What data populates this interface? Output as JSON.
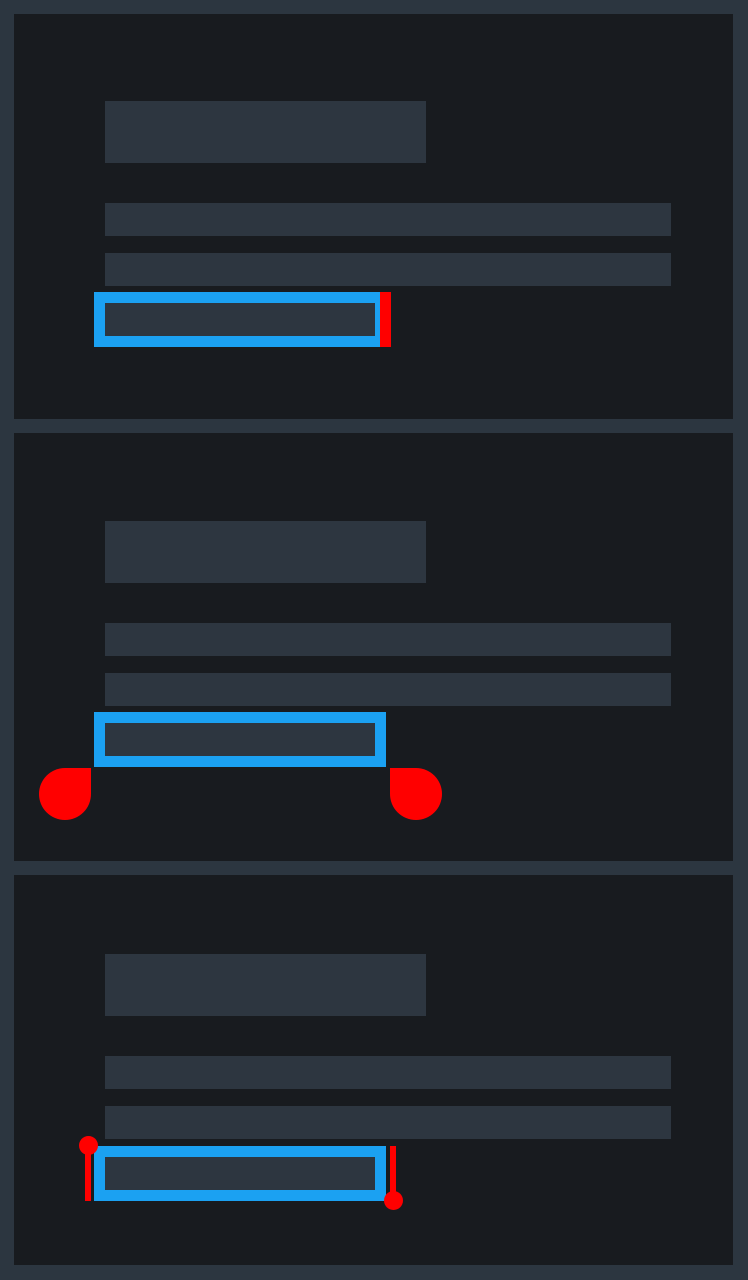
{
  "title": "",
  "panels": [
    {
      "id": "caret",
      "selection_handle_style": "bar"
    },
    {
      "id": "teardrop",
      "selection_handle_style": "teardrop"
    },
    {
      "id": "lollipop",
      "selection_handle_style": "lollipop"
    }
  ],
  "colors": {
    "background": "#2c3640",
    "panel": "#181b1f",
    "placeholder_block": "#2d3640",
    "selection_outline": "#1ba1f2",
    "handle": "#ff0000"
  }
}
